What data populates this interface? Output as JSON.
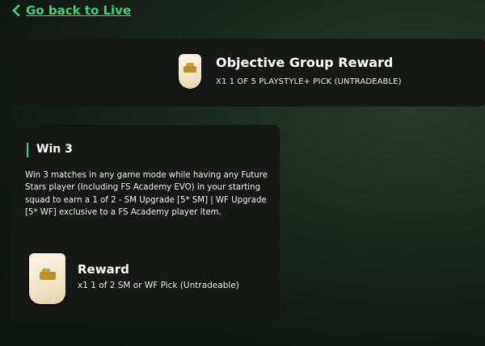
{
  "nav": {
    "back_label": "Go back to Live"
  },
  "group_reward": {
    "title": "Objective Group Reward",
    "subtitle": "X1 1 OF 5 PLAYSTYLE+ PICK (UNTRADEABLE)"
  },
  "objective": {
    "title": "Win 3",
    "description": "Win 3 matches in any game mode while having any Future Stars player (Including FS Academy EVO) in your starting squad to earn a 1 of 2 - SM Upgrade [5* SM] | WF Upgrade [5* WF] exclusive to a FS Academy player item.",
    "reward_title": "Reward",
    "reward_subtitle": "x1 1 of 2 SM or WF Pick (Untradeable)"
  },
  "colors": {
    "accent": "#3fd07a",
    "card_bg": "#161816"
  },
  "icons": {
    "back": "chevron-left-icon",
    "reward": "pack-card-icon"
  }
}
